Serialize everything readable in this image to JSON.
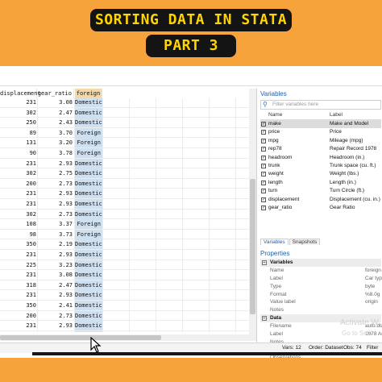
{
  "banner": {
    "line1": "SORTING DATA IN STATA",
    "line2": "PART 3"
  },
  "grid": {
    "headers": [
      "displacement",
      "gear_ratio",
      "foreign"
    ],
    "rows": [
      [
        "231",
        "3.08",
        "Domestic"
      ],
      [
        "302",
        "2.47",
        "Domestic"
      ],
      [
        "250",
        "2.43",
        "Domestic"
      ],
      [
        "89",
        "3.70",
        "Foreign"
      ],
      [
        "131",
        "3.20",
        "Foreign"
      ],
      [
        "90",
        "3.78",
        "Foreign"
      ],
      [
        "231",
        "2.93",
        "Domestic"
      ],
      [
        "302",
        "2.75",
        "Domestic"
      ],
      [
        "200",
        "2.73",
        "Domestic"
      ],
      [
        "231",
        "2.93",
        "Domestic"
      ],
      [
        "231",
        "2.93",
        "Domestic"
      ],
      [
        "302",
        "2.73",
        "Domestic"
      ],
      [
        "108",
        "3.37",
        "Foreign"
      ],
      [
        "98",
        "3.73",
        "Foreign"
      ],
      [
        "350",
        "2.19",
        "Domestic"
      ],
      [
        "231",
        "2.93",
        "Domestic"
      ],
      [
        "225",
        "3.23",
        "Domestic"
      ],
      [
        "231",
        "3.08",
        "Domestic"
      ],
      [
        "318",
        "2.47",
        "Domestic"
      ],
      [
        "231",
        "2.93",
        "Domestic"
      ],
      [
        "350",
        "2.41",
        "Domestic"
      ],
      [
        "200",
        "2.73",
        "Domestic"
      ],
      [
        "231",
        "2.93",
        "Domestic"
      ]
    ]
  },
  "variables": {
    "title": "Variables",
    "filter_placeholder": "Filter variables here",
    "col_name": "Name",
    "col_label": "Label",
    "items": [
      {
        "name": "make",
        "label": "Make and Model"
      },
      {
        "name": "price",
        "label": "Price"
      },
      {
        "name": "mpg",
        "label": "Mileage (mpg)"
      },
      {
        "name": "rep78",
        "label": "Repair Record 1978"
      },
      {
        "name": "headroom",
        "label": "Headroom (in.)"
      },
      {
        "name": "trunk",
        "label": "Trunk space (cu. ft.)"
      },
      {
        "name": "weight",
        "label": "Weight (lbs.)"
      },
      {
        "name": "length",
        "label": "Length (in.)"
      },
      {
        "name": "turn",
        "label": "Turn Circle (ft.)"
      },
      {
        "name": "displacement",
        "label": "Displacement (cu. in.)"
      },
      {
        "name": "gear_ratio",
        "label": "Gear Ratio"
      }
    ],
    "tabs": [
      "Variables",
      "Snapshots"
    ]
  },
  "properties": {
    "title": "Properties",
    "variables_section": "Variables",
    "var_props": [
      {
        "k": "Name",
        "v": "foreign"
      },
      {
        "k": "Label",
        "v": "Car type"
      },
      {
        "k": "Type",
        "v": "byte"
      },
      {
        "k": "Format",
        "v": "%8.0g"
      },
      {
        "k": "Value label",
        "v": "origin"
      },
      {
        "k": "Notes",
        "v": ""
      }
    ],
    "data_section": "Data",
    "data_props": [
      {
        "k": "Filename",
        "v": "auto.dta"
      },
      {
        "k": "Label",
        "v": "1978 Auto"
      },
      {
        "k": "Notes",
        "v": ""
      },
      {
        "k": "Variables",
        "v": ""
      },
      {
        "k": "Observations",
        "v": ""
      }
    ]
  },
  "watermark": {
    "line1": "Activate W",
    "line2": "Go to Setti"
  },
  "status": {
    "vars": "Vars: 12",
    "order": "Order: Dataset",
    "obs": "Obs: 74",
    "filter": "Filter"
  }
}
